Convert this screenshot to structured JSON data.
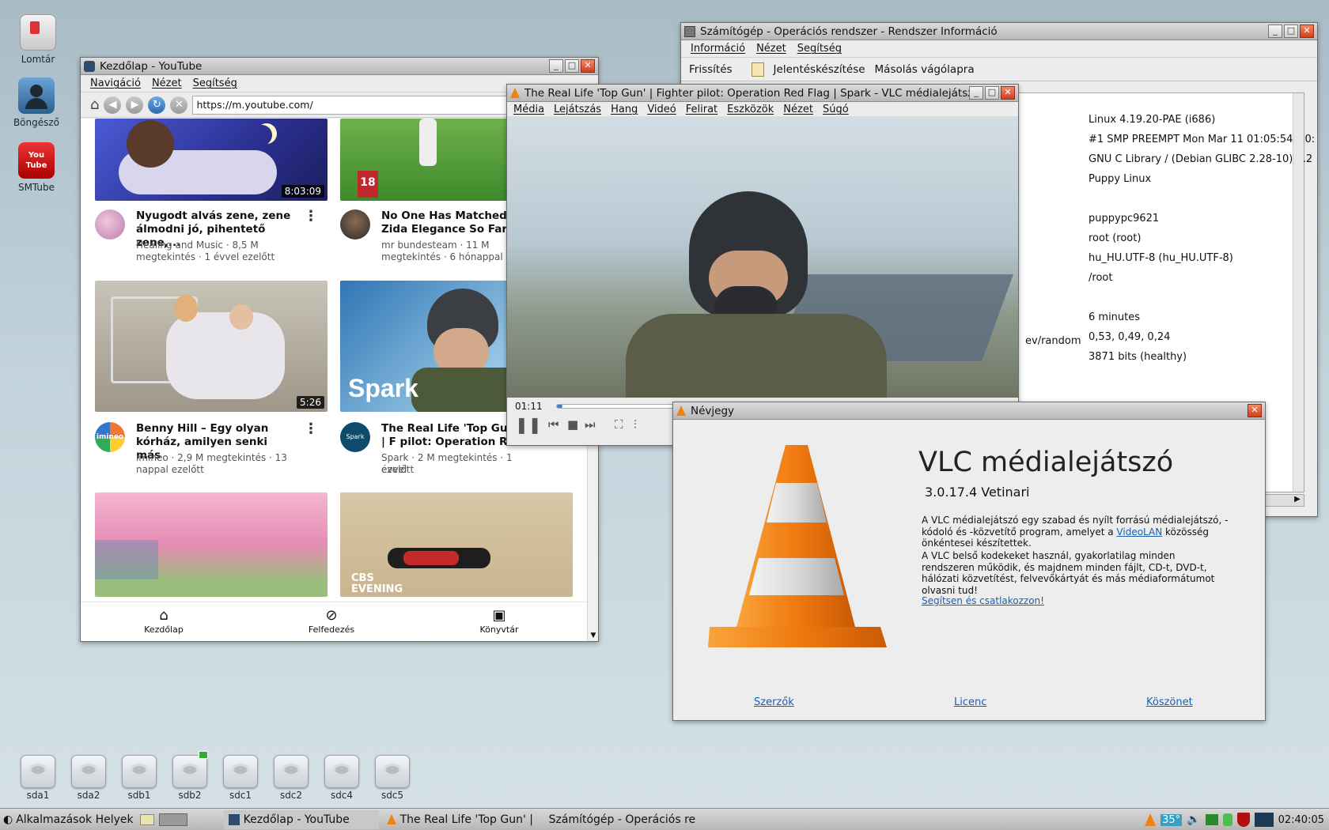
{
  "desktop_icons": [
    {
      "label": "Lomtár",
      "icon": "trash-icon"
    },
    {
      "label": "Böngésző",
      "icon": "browser-icon"
    },
    {
      "label": "SMTube",
      "icon": "youtube-icon"
    }
  ],
  "drives": [
    "sda1",
    "sda2",
    "sdb1",
    "sdb2",
    "sdc1",
    "sdc2",
    "sdc4",
    "sdc5"
  ],
  "youtube_window": {
    "title": "Kezdőlap - YouTube",
    "menu": [
      "Navigáció",
      "Nézet",
      "Segítség"
    ],
    "url": "https://m.youtube.com/",
    "videos": [
      {
        "title": "Nyugodt alvás zene, zene álmodni jó, pihentető zene,...",
        "meta1": "Healing and Music · 8,5 M",
        "meta2": "megtekintés · 1 évvel ezelőtt",
        "duration": "8:03:09"
      },
      {
        "title": "No One Has Matched Zida Elegance So Far",
        "meta1": "mr bundesteam · 11 M",
        "meta2": "megtekintés · 6 hónappal eze",
        "duration": ""
      },
      {
        "title": "Benny Hill – Egy olyan kórház, amilyen senki más",
        "meta1": "imineo · 2,9 M megtekintés · 13",
        "meta2": "nappal ezelőtt",
        "duration": "5:26"
      },
      {
        "title": "The Real Life 'Top Gun' | F pilot: Operation Red Flag | Spark",
        "meta1": "Spark · 2 M megtekintés · 1 évvel",
        "meta2": "ezelőtt",
        "duration": ""
      }
    ],
    "thumb_text": {
      "spark": "Spark",
      "cbs": "CBS EVENING",
      "imineo": "imineo",
      "spark_avatar": "Spark"
    },
    "bottom_nav": [
      "Kezdőlap",
      "Felfedezés",
      "Könyvtár"
    ]
  },
  "sysinfo_window": {
    "title": "Számítógép - Operációs rendszer - Rendszer Információ",
    "menu": [
      "Információ",
      "Nézet",
      "Segítség"
    ],
    "toolbar": [
      "Frissítés",
      "Jelentéskészítése",
      "Másolás vágólapra"
    ],
    "partial_label": "ev/random",
    "values": [
      "Linux 4.19.20-PAE (i686)",
      "#1 SMP PREEMPT Mon Mar 11 01:05:54 +0:",
      "GNU C Library / (Debian GLIBC 2.28-10) 2.2",
      "Puppy Linux",
      "puppypc9621",
      "root (root)",
      "hu_HU.UTF-8 (hu_HU.UTF-8)",
      "/root",
      "6 minutes",
      "0,53, 0,49, 0,24",
      "3871 bits (healthy)"
    ]
  },
  "vlc_window": {
    "title": "The Real Life 'Top Gun' | Fighter pilot: Operation Red Flag | Spark - VLC médialejátsző",
    "menu": [
      "Média",
      "Lejátszás",
      "Hang",
      "Videó",
      "Felirat",
      "Eszközök",
      "Nézet",
      "Súgó"
    ],
    "time": "01:11",
    "progress": 0.02
  },
  "about_window": {
    "title": "Névjegy",
    "app_name": "VLC médialejátszó",
    "version": "3.0.17.4 Vetinari",
    "p1_a": "A VLC médialejátszó egy szabad és nyílt forrású médialejátszó, -kódoló és -közvetítő program, amelyet a ",
    "p1_link": "VideoLAN",
    "p1_b": " közösség önkéntesei készítettek.",
    "p2": "A VLC belső kodekeket használ, gyakorlatilag minden rendszeren működik, és majdnem minden fájlt, CD-t, DVD-t, hálózati közvetítést, felvevőkártyát és más médiaformátumot olvasni tud!",
    "join_link": "Segítsen és csatlakozzon!",
    "footer_links": [
      "Szerzők",
      "Licenc",
      "Köszönet"
    ]
  },
  "taskbar": {
    "menu": "Alkalmazások Helyek",
    "tasks": [
      "Kezdőlap - YouTube",
      "The Real Life 'Top Gun' | Fi",
      "Számítógép - Operációs re"
    ],
    "temperature": "35°",
    "clock": "02:40:05"
  }
}
